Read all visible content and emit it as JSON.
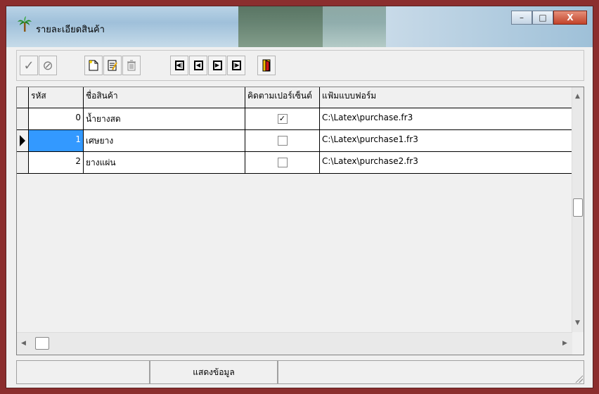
{
  "window": {
    "title": "รายละเอียดสินค้า",
    "caption": {
      "minimize": "–",
      "maximize": "□",
      "close": "X"
    }
  },
  "toolbar": {
    "buttons": [
      {
        "name": "post-icon",
        "glyph": "✓"
      },
      {
        "name": "cancel-icon",
        "glyph": "⊘"
      },
      {
        "name": "new-icon",
        "glyph": "🗋"
      },
      {
        "name": "edit-icon",
        "glyph": "✎"
      },
      {
        "name": "delete-icon",
        "glyph": "🗑"
      },
      {
        "name": "first-icon",
        "glyph": "⏮"
      },
      {
        "name": "prior-icon",
        "glyph": "◀"
      },
      {
        "name": "next-icon",
        "glyph": "▶"
      },
      {
        "name": "last-icon",
        "glyph": "⏭"
      },
      {
        "name": "exit-icon",
        "glyph": "🚪"
      }
    ]
  },
  "grid": {
    "columns": [
      "รหัส",
      "ชื่อสินค้า",
      "คิดตามเปอร์เซ็นต์",
      "แฟ้มแบบฟอร์ม"
    ],
    "rows": [
      {
        "code": "0",
        "name": "น้ำยางสด",
        "percent": true,
        "form": "C:\\Latex\\purchase.fr3"
      },
      {
        "code": "1",
        "name": "เศษยาง",
        "percent": false,
        "form": "C:\\Latex\\purchase1.fr3"
      },
      {
        "code": "2",
        "name": "ยางแผ่น",
        "percent": false,
        "form": "C:\\Latex\\purchase2.fr3"
      }
    ]
  },
  "status": {
    "panel2": "แสดงข้อมูล"
  },
  "colors": {
    "frame": "#8b2e2e",
    "selection": "#3399ff"
  }
}
